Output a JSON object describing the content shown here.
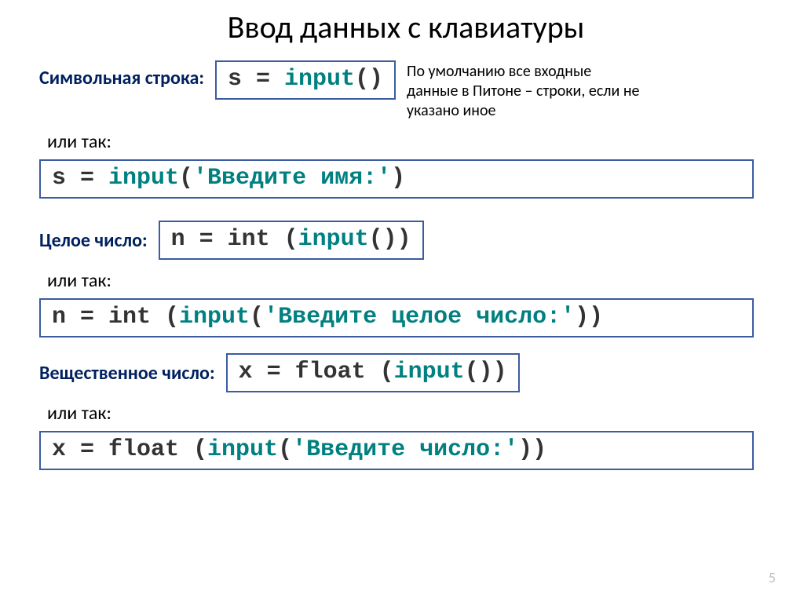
{
  "title": "Ввод данных с клавиатуры",
  "labels": {
    "string_row": "Символьная строка:",
    "or1": "или так:",
    "int_row": "Целое число:",
    "or2": "или так:",
    "float_row": "Вещественное число:",
    "or3": "или так:"
  },
  "note": "По умолчанию все входные данные в Питоне – строки, если не указано иное",
  "code": {
    "c1_pre": "s = ",
    "c1_kw": "input",
    "c1_post": "()",
    "c2_pre": "s = ",
    "c2_kw": "input",
    "c2_lpar": "(",
    "c2_str": "'Введите имя:'",
    "c2_rpar": ")",
    "c3_pre": "n = int (",
    "c3_kw": "input",
    "c3_post": "())",
    "c4_pre": "n = int (",
    "c4_kw": "input",
    "c4_lpar": "(",
    "c4_str": "'Введите целое число:'",
    "c4_rpar": "))",
    "c5_pre": "x = float (",
    "c5_kw": "input",
    "c5_post": "())",
    "c6_pre": "x = float (",
    "c6_kw": "input",
    "c6_lpar": "(",
    "c6_str": "'Введите число:'",
    "c6_rpar": "))"
  },
  "page_number": "5"
}
